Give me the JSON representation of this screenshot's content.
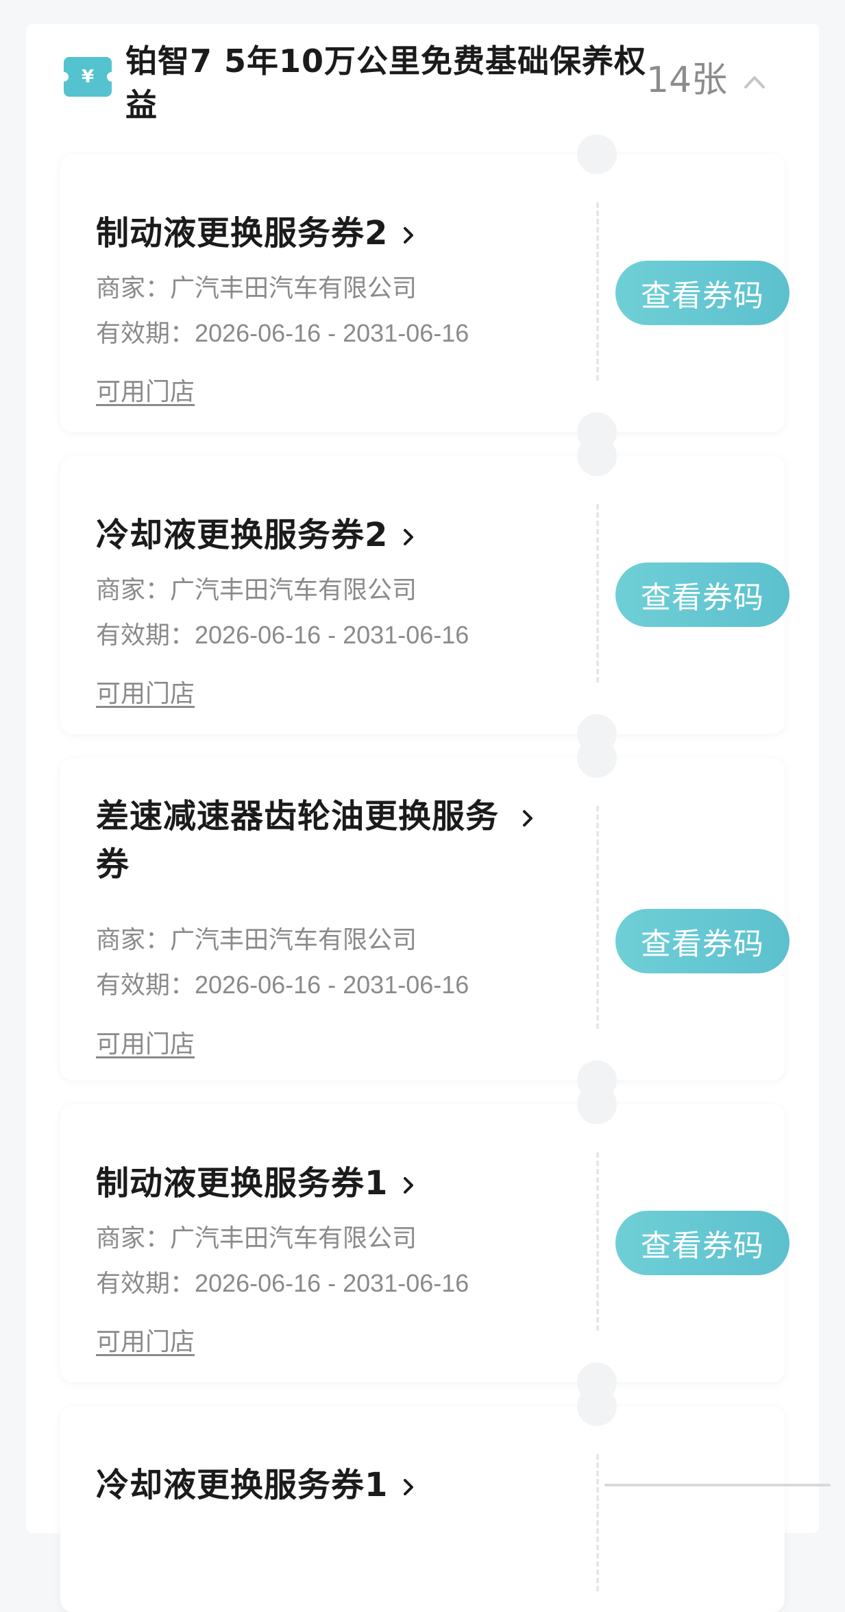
{
  "header": {
    "title": "铂智7 5年10万公里免费基础保养权益",
    "count": "14张",
    "icon_symbol": "¥"
  },
  "coupons": [
    {
      "title": "制动液更换服务券2",
      "merchant": "商家：广汽丰田汽车有限公司",
      "validity": "有效期：2026-06-16 - 2031-06-16",
      "stores": "可用门店",
      "button": "查看券码"
    },
    {
      "title": "冷却液更换服务券2",
      "merchant": "商家：广汽丰田汽车有限公司",
      "validity": "有效期：2026-06-16 - 2031-06-16",
      "stores": "可用门店",
      "button": "查看券码"
    },
    {
      "title_line1": "差速减速器齿轮油更换服务",
      "title_line2": "券",
      "merchant": "商家：广汽丰田汽车有限公司",
      "validity": "有效期：2026-06-16 - 2031-06-16",
      "stores": "可用门店",
      "button": "查看券码"
    },
    {
      "title": "制动液更换服务券1",
      "merchant": "商家：广汽丰田汽车有限公司",
      "validity": "有效期：2026-06-16 - 2031-06-16",
      "stores": "可用门店",
      "button": "查看券码"
    },
    {
      "title": "冷却液更换服务券1"
    }
  ],
  "colors": {
    "accent": "#5cc0ce",
    "text_primary": "#1b1b1b",
    "text_secondary": "#8a8a8a",
    "background": "#f6f7f8"
  }
}
